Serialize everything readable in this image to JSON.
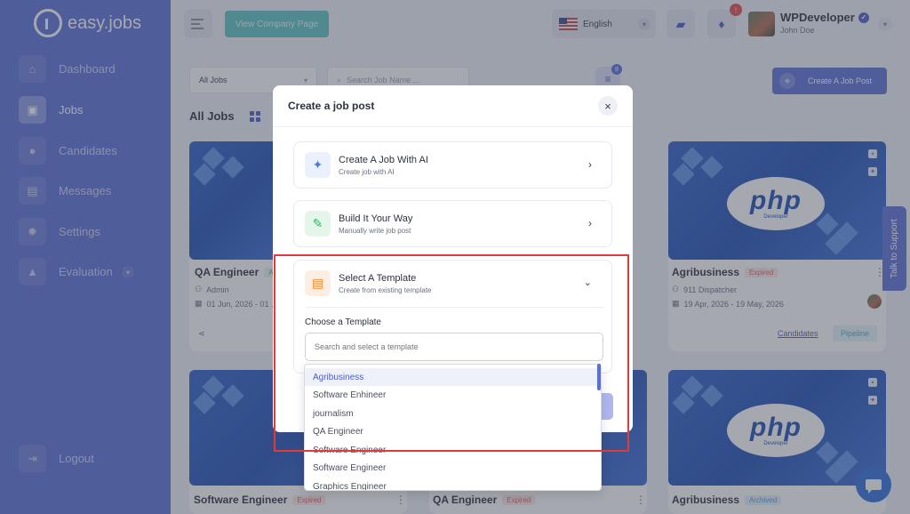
{
  "app": {
    "name": "easy.jobs"
  },
  "sidebar": {
    "items": [
      {
        "label": "Dashboard",
        "icon": "home-icon"
      },
      {
        "label": "Jobs",
        "icon": "briefcase-icon"
      },
      {
        "label": "Candidates",
        "icon": "user-icon"
      },
      {
        "label": "Messages",
        "icon": "chat-icon"
      },
      {
        "label": "Settings",
        "icon": "gear-icon"
      },
      {
        "label": "Evaluation",
        "icon": "graduation-cap-icon"
      }
    ],
    "logout": "Logout"
  },
  "header": {
    "company_button": "View Company Page",
    "language": "English",
    "notification_count": "!",
    "company_name": "WPDeveloper",
    "user_name": "John Doe"
  },
  "filters": {
    "job_select": "All Jobs",
    "search_placeholder": "Search Job Name ...",
    "filter_count": "8",
    "create_button": "Create A Job Post",
    "all_jobs_title": "All Jobs"
  },
  "cards": [
    {
      "title": "QA Engineer",
      "badge": "Active",
      "author": "Admin",
      "dates": "01 Jun, 2026 - 01 ..."
    },
    {
      "title": "Agribusiness",
      "badge": "Expired",
      "author": "911 Dispatcher",
      "dates": "19 Apr, 2026 - 19 May, 2026",
      "candidates": "Candidates",
      "pipeline": "Pipeline",
      "php": "php",
      "php_sub": "Developer"
    },
    {
      "title": "Software Engineer",
      "badge": "Expired"
    },
    {
      "title": "QA Engineer",
      "badge": "Expired"
    },
    {
      "title": "Agribusiness",
      "badge": "Archived",
      "php": "php",
      "php_sub": "Developer"
    }
  ],
  "side_tab": "Talk to Support",
  "modal": {
    "title": "Create a job post",
    "options": [
      {
        "title": "Create A Job With AI",
        "subtitle": "Create job with AI",
        "icon": "sparkle-icon"
      },
      {
        "title": "Build It Your Way",
        "subtitle": "Manually write job post",
        "icon": "quill-icon"
      },
      {
        "title": "Select A Template",
        "subtitle": "Create from existing template",
        "icon": "template-icon"
      }
    ],
    "choose_label": "Choose a Template",
    "search_placeholder": "Search and select a template",
    "templates": [
      "Agribusiness",
      "Software Enhineer",
      "journalism",
      "QA Engineer",
      "Software Engineer",
      "Software Engineer",
      "Graphics Engineer"
    ]
  },
  "colors": {
    "brand": "#5b6fd6",
    "teal": "#5cc3c1",
    "highlight": "#e03b3b"
  }
}
